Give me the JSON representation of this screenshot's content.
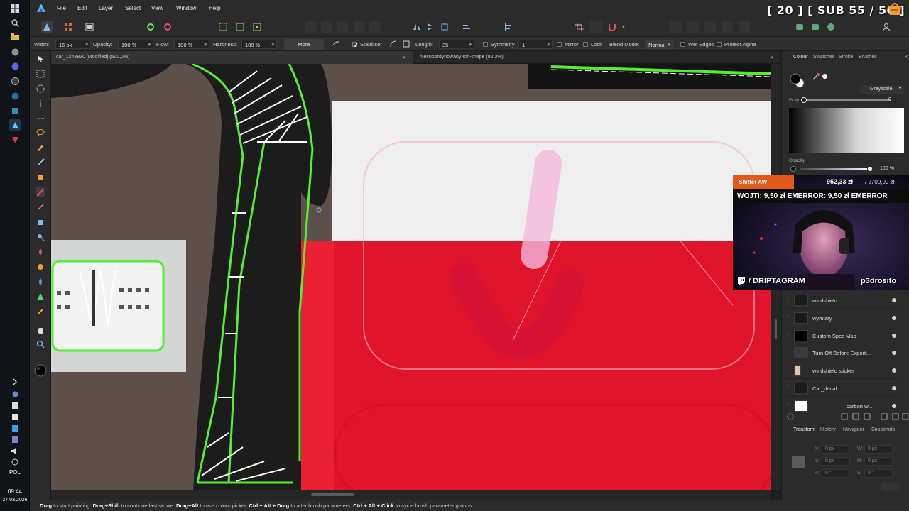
{
  "taskbar": {
    "language": "POL",
    "time": "09:44",
    "date": "27.03.2026"
  },
  "menu": {
    "items": [
      "File",
      "Edit",
      "Layer",
      "Select",
      "View",
      "Window",
      "Help"
    ]
  },
  "stream_overlay": {
    "sub_counter": "[ 20 ]    [ SUB 55 / 50 ]",
    "webcam": {
      "tag": "Shifter AW",
      "progress_amount": "952,33 zł",
      "progress_goal": "/ 2700,00 zł",
      "donations_ticker": "WOJTI: 9,50 zł    EMERROR: 9,50 zł    EMERROR",
      "twitch_handle": "/ DRIPTAGRAM",
      "streamer_name": "p3drosito"
    }
  },
  "context_toolbar": {
    "width_label": "Width:",
    "width_value": "16 px",
    "opacity_label": "Opacity:",
    "opacity_value": "100 %",
    "flow_label": "Flow:",
    "flow_value": "100 %",
    "hardness_label": "Hardness:",
    "hardness_value": "100 %",
    "more_label": "More",
    "stabiliser_label": "Stabiliser",
    "length_label": "Length:",
    "length_value": "35",
    "symmetry_label": "Symmetry",
    "symmetry_value": "1",
    "mirror_label": "Mirror",
    "lock_label": "Lock",
    "blend_mode_label": "Blend Mode:",
    "blend_mode_value": "Normal",
    "wet_edges_label": "Wet Edges",
    "protect_alpha_label": "Protect Alpha"
  },
  "documents": {
    "tabs": [
      {
        "title": "car_1248820 [Modified] (500,0%)",
        "close": "×"
      },
      {
        "title": "niesubordynowany-sm-shape (82,2%)",
        "close": "×"
      }
    ],
    "panel_close": "×"
  },
  "colour_panel": {
    "tabs": [
      "Colour",
      "Swatches",
      "Stroke",
      "Brushes"
    ],
    "mode": "Greyscale",
    "gray_label": "Gray:",
    "gray_value": "0",
    "opacity_label": "Opacity",
    "opacity_value": "100 %"
  },
  "layers": [
    {
      "name": "windshield"
    },
    {
      "name": "wymiary"
    },
    {
      "name": "Custom Spec Map"
    },
    {
      "name": "Turn Off Before Exporti..."
    },
    {
      "name": "windshield sticker"
    },
    {
      "name": "Car_decal"
    },
    {
      "name": "carbon wl..."
    }
  ],
  "transform_panel": {
    "tabs": [
      "Transform",
      "History",
      "Navigator",
      "Snapshots"
    ],
    "x_label": "X:",
    "x_value": "0 px",
    "w_label": "W:",
    "w_value": "0 px",
    "y_label": "Y:",
    "y_value": "0 px",
    "h_label": "H:",
    "h_value": "0 px",
    "r_label": "R:",
    "r_value": "0 °",
    "s_label": "S:",
    "s_value": "0 °"
  },
  "statusbar": {
    "parts": [
      {
        "b": "Drag",
        "t": " to start painting. "
      },
      {
        "b": "Drag+Shift",
        "t": " to continue last stroke. "
      },
      {
        "b": "Drag+Alt",
        "t": " to use colour picker. "
      },
      {
        "b": "Ctrl + Alt + Drag",
        "t": " to alter brush parameters. "
      },
      {
        "b": "Ctrl + Alt + Click",
        "t": " to cycle brush parameter groups."
      }
    ]
  },
  "colors": {
    "flag_white": "#eeeeee",
    "flag_red": "#e0142b",
    "outline_green": "#55ee33",
    "asphalt": "#1c1c1c",
    "background_brown": "#5d504a",
    "accent_orange": "#e2591a"
  }
}
